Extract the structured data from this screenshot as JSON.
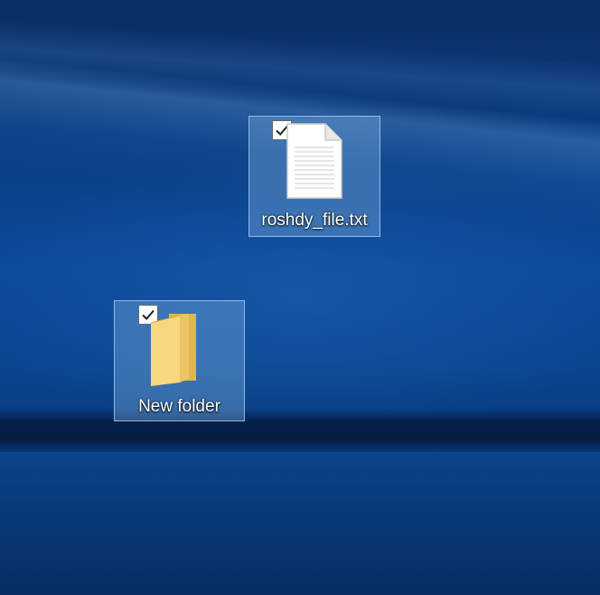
{
  "desktop": {
    "icons": [
      {
        "label": "roshdy_file.txt",
        "type": "text-file-icon",
        "selected": true,
        "checked": true
      },
      {
        "label": "New folder",
        "type": "folder-icon",
        "selected": true,
        "checked": true
      }
    ]
  },
  "colors": {
    "wallpaper": "#0b4a9a",
    "selection_fill": "#78aadc",
    "selection_border": "#aad2f5",
    "folder_front": "#f5d37a",
    "folder_back": "#e0b24a",
    "label_text": "#ffffff"
  }
}
